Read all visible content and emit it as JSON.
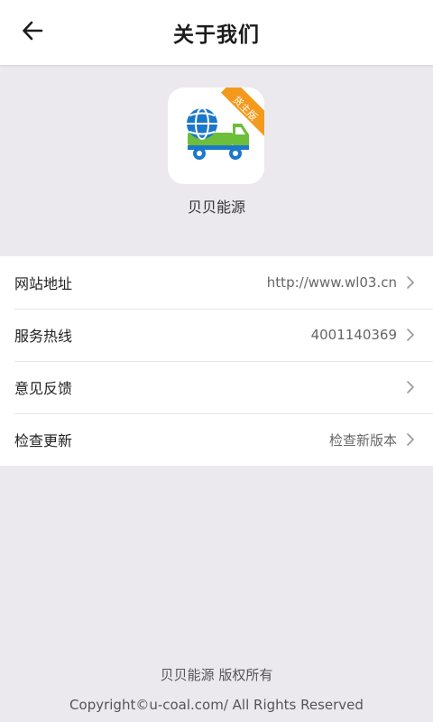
{
  "header": {
    "title": "关于我们",
    "back_icon": "arrow-left-icon"
  },
  "app": {
    "name": "贝贝能源",
    "badge": "货主版",
    "colors": {
      "badge": "#f39a1d",
      "globe": "#1b78c8",
      "truck": "#6dbe3b"
    }
  },
  "list": {
    "items": [
      {
        "label": "网站地址",
        "value": "http://www.wl03.cn"
      },
      {
        "label": "服务热线",
        "value": "4001140369"
      },
      {
        "label": "意见反馈",
        "value": ""
      },
      {
        "label": "检查更新",
        "value": "检查新版本"
      }
    ],
    "chevron_icon": "chevron-right-icon"
  },
  "footer": {
    "line1": "贝贝能源 版权所有",
    "line2": "Copyright©u-coal.com/ All Rights Reserved"
  }
}
